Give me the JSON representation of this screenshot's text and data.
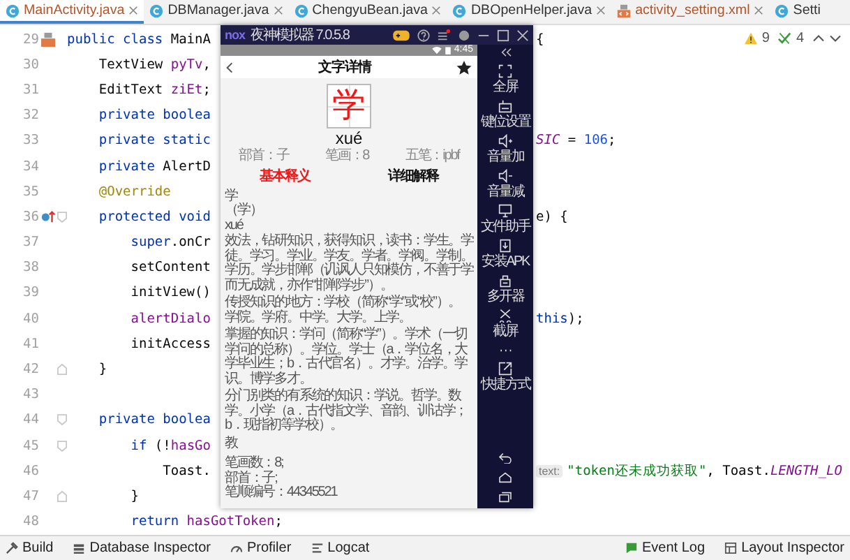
{
  "tabs": [
    {
      "label": "MainActivity.java",
      "kind": "java",
      "selected": true,
      "modified": true,
      "closable": true
    },
    {
      "label": "DBManager.java",
      "kind": "java",
      "selected": false,
      "modified": false,
      "closable": true
    },
    {
      "label": "ChengyuBean.java",
      "kind": "java",
      "selected": false,
      "modified": false,
      "closable": true
    },
    {
      "label": "DBOpenHelper.java",
      "kind": "java",
      "selected": false,
      "modified": false,
      "closable": true
    },
    {
      "label": "activity_setting.xml",
      "kind": "xml",
      "selected": false,
      "modified": true,
      "closable": true
    },
    {
      "label": "Setti",
      "kind": "java",
      "selected": false,
      "modified": false,
      "closable": false
    }
  ],
  "inspection": {
    "warnings": "9",
    "checks": "4"
  },
  "code": [
    {
      "number": "29",
      "gutter": {
        "kind": "layout"
      },
      "tokens": [
        {
          "kind": "kw",
          "text": "public class "
        },
        {
          "kind": "plain",
          "text": "MainA"
        }
      ],
      "right": [
        {
          "kind": "plain",
          "text": "{"
        }
      ]
    },
    {
      "number": "30",
      "tokens": [
        {
          "kind": "plain",
          "text": "    TextView "
        },
        {
          "kind": "field",
          "text": "pyTv"
        },
        {
          "kind": "plain",
          "text": ","
        }
      ]
    },
    {
      "number": "31",
      "tokens": [
        {
          "kind": "plain",
          "text": "    EditText "
        },
        {
          "kind": "field",
          "text": "ziEt"
        },
        {
          "kind": "plain",
          "text": ";"
        }
      ]
    },
    {
      "number": "32",
      "tokens": [
        {
          "kind": "kw",
          "text": "    private boolea"
        }
      ]
    },
    {
      "number": "33",
      "tokens": [
        {
          "kind": "kw",
          "text": "    private static"
        }
      ],
      "right": [
        {
          "kind": "const",
          "text": "SIC"
        },
        {
          "kind": "plain",
          "text": " = "
        },
        {
          "kind": "num",
          "text": "106"
        },
        {
          "kind": "plain",
          "text": ";"
        }
      ]
    },
    {
      "number": "34",
      "tokens": [
        {
          "kind": "kw",
          "text": "    private "
        },
        {
          "kind": "plain",
          "text": "AlertD"
        }
      ]
    },
    {
      "number": "35",
      "tokens": [
        {
          "kind": "anno",
          "text": "    @Override"
        }
      ]
    },
    {
      "number": "36",
      "gutter": {
        "kind": "override"
      },
      "fold": {
        "kind": "open"
      },
      "tokens": [
        {
          "kind": "kw",
          "text": "    protected void"
        }
      ],
      "right": [
        {
          "kind": "plain",
          "text": "e) {"
        }
      ]
    },
    {
      "number": "37",
      "tokens": [
        {
          "kind": "kw",
          "text": "        super"
        },
        {
          "kind": "plain",
          "text": ".onCr"
        }
      ]
    },
    {
      "number": "38",
      "tokens": [
        {
          "kind": "plain",
          "text": "        setContent"
        }
      ]
    },
    {
      "number": "39",
      "tokens": [
        {
          "kind": "plain",
          "text": "        initView()"
        }
      ]
    },
    {
      "number": "40",
      "tokens": [
        {
          "kind": "field",
          "text": "        alertDialo"
        }
      ],
      "right": [
        {
          "kind": "kw",
          "text": "this"
        },
        {
          "kind": "plain",
          "text": ");"
        }
      ]
    },
    {
      "number": "41",
      "tokens": [
        {
          "kind": "plain",
          "text": "        initAccess"
        }
      ]
    },
    {
      "number": "42",
      "fold": {
        "kind": "close"
      },
      "tokens": [
        {
          "kind": "plain",
          "text": "    }"
        }
      ]
    },
    {
      "number": "43"
    },
    {
      "number": "44",
      "fold": {
        "kind": "open"
      },
      "tokens": [
        {
          "kind": "kw",
          "text": "    private boolea"
        }
      ]
    },
    {
      "number": "45",
      "fold": {
        "kind": "open"
      },
      "tokens": [
        {
          "kind": "kw",
          "text": "        if "
        },
        {
          "kind": "plain",
          "text": "(!"
        },
        {
          "kind": "field",
          "text": "hasGo"
        }
      ]
    },
    {
      "number": "46",
      "tokens": [
        {
          "kind": "plain",
          "text": "            Toast."
        }
      ],
      "right": [
        {
          "kind": "hint",
          "text": "text:"
        },
        {
          "kind": "str",
          "text": "\"token还未成功获取\""
        },
        {
          "kind": "plain",
          "text": ", Toast."
        },
        {
          "kind": "const",
          "text": "LENGTH_LO"
        }
      ]
    },
    {
      "number": "47",
      "fold": {
        "kind": "close"
      },
      "tokens": [
        {
          "kind": "plain",
          "text": "        }"
        }
      ]
    },
    {
      "number": "48",
      "tokens": [
        {
          "kind": "kw",
          "text": "        return "
        },
        {
          "kind": "field",
          "text": "hasGotToken"
        },
        {
          "kind": "plain",
          "text": ";"
        }
      ]
    }
  ],
  "emulator": {
    "logo": "nox",
    "title": "夜神模拟器 7.0.5.8",
    "title_buttons": [
      {
        "kind": "gamepad"
      },
      {
        "kind": "help"
      },
      {
        "kind": "menu",
        "badge": true
      },
      {
        "kind": "record"
      },
      {
        "kind": "minimize"
      },
      {
        "kind": "maximize"
      },
      {
        "kind": "close"
      }
    ],
    "sidebar": [
      {
        "kind": "fullscreen",
        "label": "全屏"
      },
      {
        "kind": "keymap",
        "label": "键位设置"
      },
      {
        "kind": "volume_up",
        "label": "音量加"
      },
      {
        "kind": "volume_down",
        "label": "音量减"
      },
      {
        "kind": "files",
        "label": "文件助手"
      },
      {
        "kind": "apk",
        "label": "安装APK"
      },
      {
        "kind": "multi",
        "label": "多开器"
      },
      {
        "kind": "screenshot",
        "label": "截屏"
      },
      {
        "kind": "more"
      },
      {
        "kind": "shortcut",
        "label": "快捷方式"
      }
    ],
    "nav": [
      {
        "kind": "back"
      },
      {
        "kind": "home"
      },
      {
        "kind": "recents"
      }
    ]
  },
  "phone": {
    "time": "4:45",
    "title": "文字详情",
    "character": "学",
    "pinyin": "xué",
    "meta": [
      "部首：子",
      "笔画：8",
      "五笔：ipbf"
    ],
    "tabs": [
      {
        "label": "基本释义",
        "selected": true
      },
      {
        "label": "详细解释",
        "selected": false
      }
    ],
    "basic": [
      {
        "kind": "line",
        "text": "学"
      },
      {
        "kind": "line",
        "text": "（学）"
      },
      {
        "kind": "line",
        "text": "xué"
      },
      {
        "kind": "para",
        "text": "效法，钻研知识，获得知识，读书：学生。学徒。学习。学业。学友。学者。学阀。学制。学历。学步邯郸（讥讽人只知模仿，不善于学而无成就，亦作“邯郸学步”）。"
      },
      {
        "kind": "para",
        "text": "传授知识的地方：学校（简称“学”或“校”）。学院。学府。中学。大学。上学。"
      },
      {
        "kind": "para",
        "text": "掌握的知识：学问（简称“学”）。学术（一切学问的总称）。学位。学士（a．学位名，大学毕业生；b．古代官名）。才学。治学。学识。博学多才。"
      },
      {
        "kind": "para",
        "text": "分门别类的有系统的知识：学说。哲学。数学。小学（a．古代指文学、音韵、训诂学；b．现指初等学校）。"
      },
      {
        "kind": "line",
        "text": "教"
      }
    ],
    "info": [
      "笔画数：8;",
      "部首：子;",
      "笔顺编号：44345521"
    ]
  },
  "bottom": {
    "left": [
      {
        "kind": "build",
        "label": "Build"
      },
      {
        "kind": "database",
        "label": "Database Inspector"
      },
      {
        "kind": "profiler",
        "label": "Profiler"
      },
      {
        "kind": "logcat",
        "label": "Logcat"
      }
    ],
    "right": [
      {
        "kind": "event",
        "label": "Event Log"
      },
      {
        "kind": "layout",
        "label": "Layout Inspector"
      }
    ]
  }
}
